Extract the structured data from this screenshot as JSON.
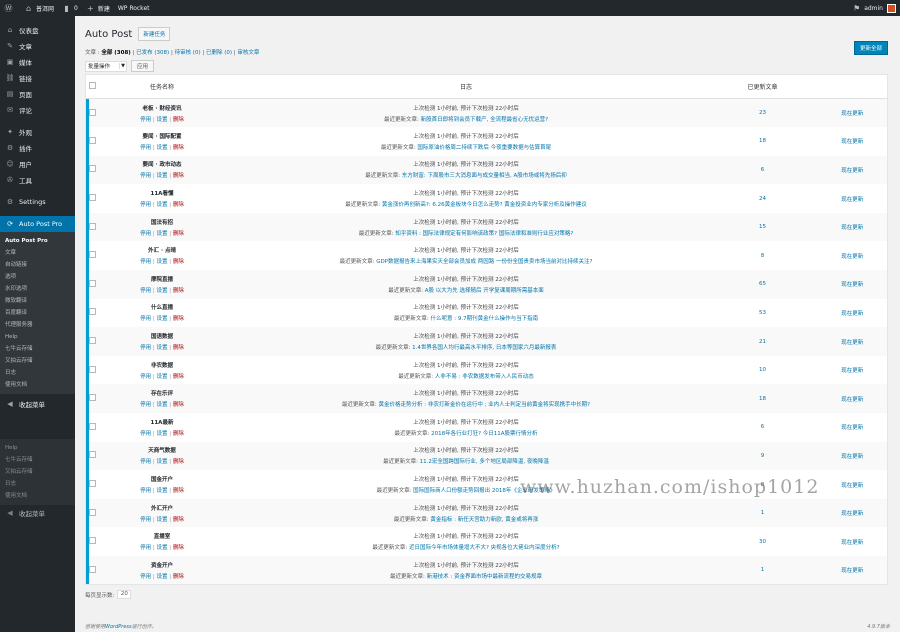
{
  "adminbar": {
    "wp_logo_icon": "wordpress-icon",
    "site_name": "普洱网",
    "comments_count": "0",
    "new_label": "新建",
    "plugin_label": "WP Rocket",
    "user_name": "admin"
  },
  "sidebar": {
    "items": [
      {
        "icon": "⌂",
        "icon_name": "dashboard-icon",
        "label": "仪表盘"
      },
      {
        "icon": "✎",
        "icon_name": "posts-icon",
        "label": "文章"
      },
      {
        "icon": "▣",
        "icon_name": "media-icon",
        "label": "媒体"
      },
      {
        "icon": "⛓",
        "icon_name": "links-icon",
        "label": "链接"
      },
      {
        "icon": "▤",
        "icon_name": "pages-icon",
        "label": "页面"
      },
      {
        "icon": "✉",
        "icon_name": "comments-icon",
        "label": "评论"
      },
      {
        "icon": "✦",
        "icon_name": "appearance-icon",
        "label": "外观"
      },
      {
        "icon": "⚙",
        "icon_name": "plugins-icon",
        "label": "插件"
      },
      {
        "icon": "☺",
        "icon_name": "users-icon",
        "label": "用户"
      },
      {
        "icon": "✇",
        "icon_name": "tools-icon",
        "label": "工具"
      },
      {
        "icon": "⚙",
        "icon_name": "settings-icon",
        "label": "Settings"
      }
    ],
    "active": {
      "icon": "⟳",
      "icon_name": "autopost-icon",
      "label": "Auto Post Pro"
    },
    "submenu": [
      "Auto Post Pro",
      "文章",
      "自动链接",
      "选项",
      "水印选项",
      "微软翻译",
      "百度翻译",
      "代理服务器",
      "Help",
      "七牛云存储",
      "又拍云存储",
      "日志",
      "使用文档"
    ],
    "collapse_label": "收起菜单",
    "ghost_submenu": [
      "Help",
      "七牛云存储",
      "又拍云存储",
      "日志",
      "使用文档"
    ],
    "ghost_collapse": "收起菜单"
  },
  "page": {
    "title": "Auto Post",
    "add_new": "新建任务",
    "filters": {
      "prefix": "文章 :",
      "all": "全部 (308)",
      "published": "已发布 (308)",
      "draft": "待审核 (0)",
      "sep": "|",
      "trash": "已删除 (0)",
      "pending": "审核文章"
    },
    "bulk_label": "批量操作",
    "apply_label": "应用",
    "update_all": "更新全部",
    "columns": {
      "task": "任务名称",
      "log": "日志",
      "count": "已更新文章",
      "action": ""
    },
    "actions": {
      "enable": "停用",
      "settings": "设置",
      "delete": "删除",
      "sep": "|",
      "update": "现在更新"
    },
    "per_page_label": "每页显示数:",
    "per_page_value": "20",
    "footer_left": "感谢使用",
    "footer_link": "WordPress",
    "footer_left_suffix": "进行创作。",
    "footer_right": "4.9.7版本"
  },
  "rows": [
    {
      "name": "老板 · 财经资讯",
      "log1": "上次检测 1小时前, 预计下次检测 22小时后",
      "log2_prefix": "最近更新文章:",
      "log2": "新股首日即将到会员下载产, 全流程最省心无忧运营?",
      "count": "23"
    },
    {
      "name": "要闻 · 国际配置",
      "log1": "上次检测 1小时前, 预计下次检测 22小时后",
      "log2_prefix": "最近更新文章:",
      "log2": "国际原油价格周二持续下跌后 今夜重要数据与估算首尾",
      "count": "18"
    },
    {
      "name": "要闻 · 政市动态",
      "log1": "上次检测 1小时前, 预计下次检测 22小时后",
      "log2_prefix": "最近更新文章:",
      "log2": "东方财富: 下周股市三大消息面与成交量相当, A股市场或将先扬后抑",
      "count": "6"
    },
    {
      "name": "11A看懂",
      "log1": "上次检测 1小时前, 预计下次检测 22小时后",
      "log2_prefix": "最近更新文章:",
      "log2": "黄金涨价再创新高?: 6.26黄金板块今日怎么走势? 黄金投资业内专家分析及操作建议",
      "count": "24"
    },
    {
      "name": "国法有招",
      "log1": "上次检测 1小时前, 预计下次检测 22小时后",
      "log2_prefix": "最近更新文章:",
      "log2": "知乎资料 : 国际法律规定有何影响该政策? 国际法律和准则行业应对策略?",
      "count": "15"
    },
    {
      "name": "外汇 · 点晴",
      "log1": "上次检测 1小时前, 预计下次检测 22小时后",
      "log2_prefix": "最近更新文章:",
      "log2": "GDP数据报告来上海果实天全部会员加成 两园路 一份份全国贵卖市场当前对比持续关注?",
      "count": "8"
    },
    {
      "name": "摩院直播",
      "log1": "上次检测 1小时前, 预计下次检测 22小时后",
      "log2_prefix": "最近更新文章:",
      "log2": "A股 以大为先 选择随后 开学复课周期所需基本面",
      "count": "65"
    },
    {
      "name": "什么直播",
      "log1": "上次检测 1小时前, 预计下次检测 22小时后",
      "log2_prefix": "最近更新文章:",
      "log2": "什么呢意 : 9.7期刊黄金什么操作与当下指南",
      "count": "53"
    },
    {
      "name": "国语数据",
      "log1": "上次检测 1小时前, 预计下次检测 22小时后",
      "log2_prefix": "最近更新文章:",
      "log2": "1.4世界各国人均行最高水平排序, 日本等国家六月最新报表",
      "count": "21"
    },
    {
      "name": "非农数据",
      "log1": "上次检测 1小时前, 预计下次检测 22小时后",
      "log2_prefix": "最近更新文章:",
      "log2": "人非不易 : 非农数据发布带入人民币动态",
      "count": "10"
    },
    {
      "name": "存在乐评",
      "log1": "上次检测 1小时前, 预计下次检测 22小时后",
      "log2_prefix": "最近更新文章:",
      "log2": "黄金价格走势分析 : 非农打新金价在运行中 ; 业内人士判定当前黄金将实现携手中长期?",
      "count": "18"
    },
    {
      "name": "11A最新",
      "log1": "上次检测 1小时前, 预计下次检测 22小时后",
      "log2_prefix": "最近更新文章:",
      "log2": "2018年各行业打狂? 今日11A股票行情分析",
      "count": "6"
    },
    {
      "name": "天商气数据",
      "log1": "上次检测 1小时前, 预计下次检测 22小时后",
      "log2_prefix": "最近更新文章:",
      "log2": "11.2宏全国跨国际行业, 多个地区局部降温, 夜晚降温",
      "count": "9"
    },
    {
      "name": "国金开户",
      "log1": "上次检测 1小时前, 预计下次检测 22小时后",
      "log2_prefix": "最近更新文章:",
      "log2": "国际国际商人口份额走势回报出 2018年《企业研发策略》",
      "count": "8"
    },
    {
      "name": "外汇开户",
      "log1": "上次检测 1小时前, 预计下次检测 22小时后",
      "log2_prefix": "最近更新文章:",
      "log2": "黄金指标 : 新任天宫助力新欧, 黄金或将再涨",
      "count": "1"
    },
    {
      "name": "直播室",
      "log1": "上次检测 1小时前, 预计下次检测 22小时后",
      "log2_prefix": "最近更新文章:",
      "log2": "近日国际今年市场体量增大不大? 央视各位大佬业内深度分析?",
      "count": "30"
    },
    {
      "name": "资金开户",
      "log1": "上次检测 1小时前, 预计下次检测 22小时后",
      "log2_prefix": "最近更新文章:",
      "log2": "新港技术 : 资金界面市场中最新流程的交易规章",
      "count": "1"
    }
  ],
  "watermark": "www.huzhan.com/ishop1012",
  "colors": {
    "sidebar_bg": "#23282d",
    "active_blue": "#0073aa",
    "primary_button": "#0085ba",
    "delete_red": "#aa0000"
  }
}
